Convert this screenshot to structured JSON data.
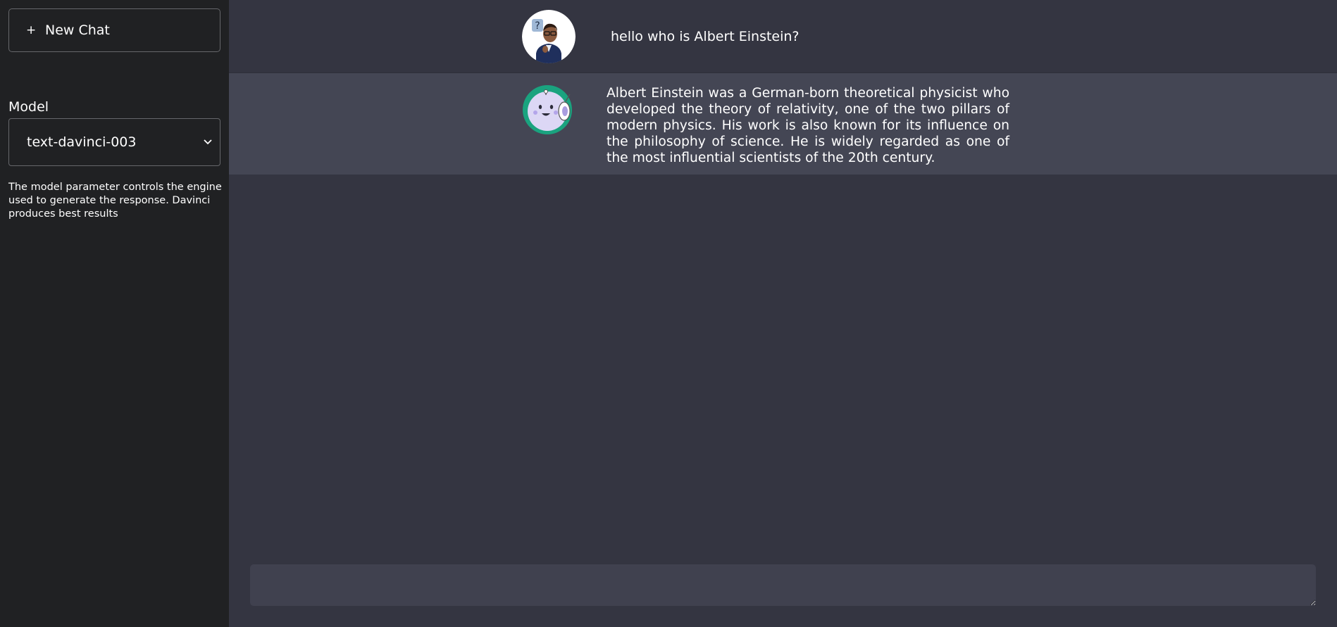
{
  "sidebar": {
    "new_chat_icon": "+",
    "new_chat_label": "New Chat",
    "model_label": "Model",
    "model_selected": "text-davinci-003",
    "model_description": "The model parameter controls the engine used to generate the response. Davinci produces best results"
  },
  "chat": {
    "messages": [
      {
        "role": "user",
        "avatar_icon": "user-avatar-icon",
        "text": "hello who is Albert Einstein?"
      },
      {
        "role": "assistant",
        "avatar_icon": "bot-avatar-icon",
        "text": "Albert Einstein was a German-born theoretical physicist who developed the theory of relativity, one of the two pillars of modern physics. His work is also known for its influence on the philosophy of science. He is widely regarded as one of the most influential scientists of the 20th century."
      }
    ]
  },
  "input": {
    "value": "",
    "placeholder": ""
  },
  "colors": {
    "sidebar_bg": "#202123",
    "main_bg": "#343541",
    "assistant_row_bg": "#444654",
    "input_bg": "#40414f",
    "bot_avatar_ring": "#1aa37f"
  }
}
